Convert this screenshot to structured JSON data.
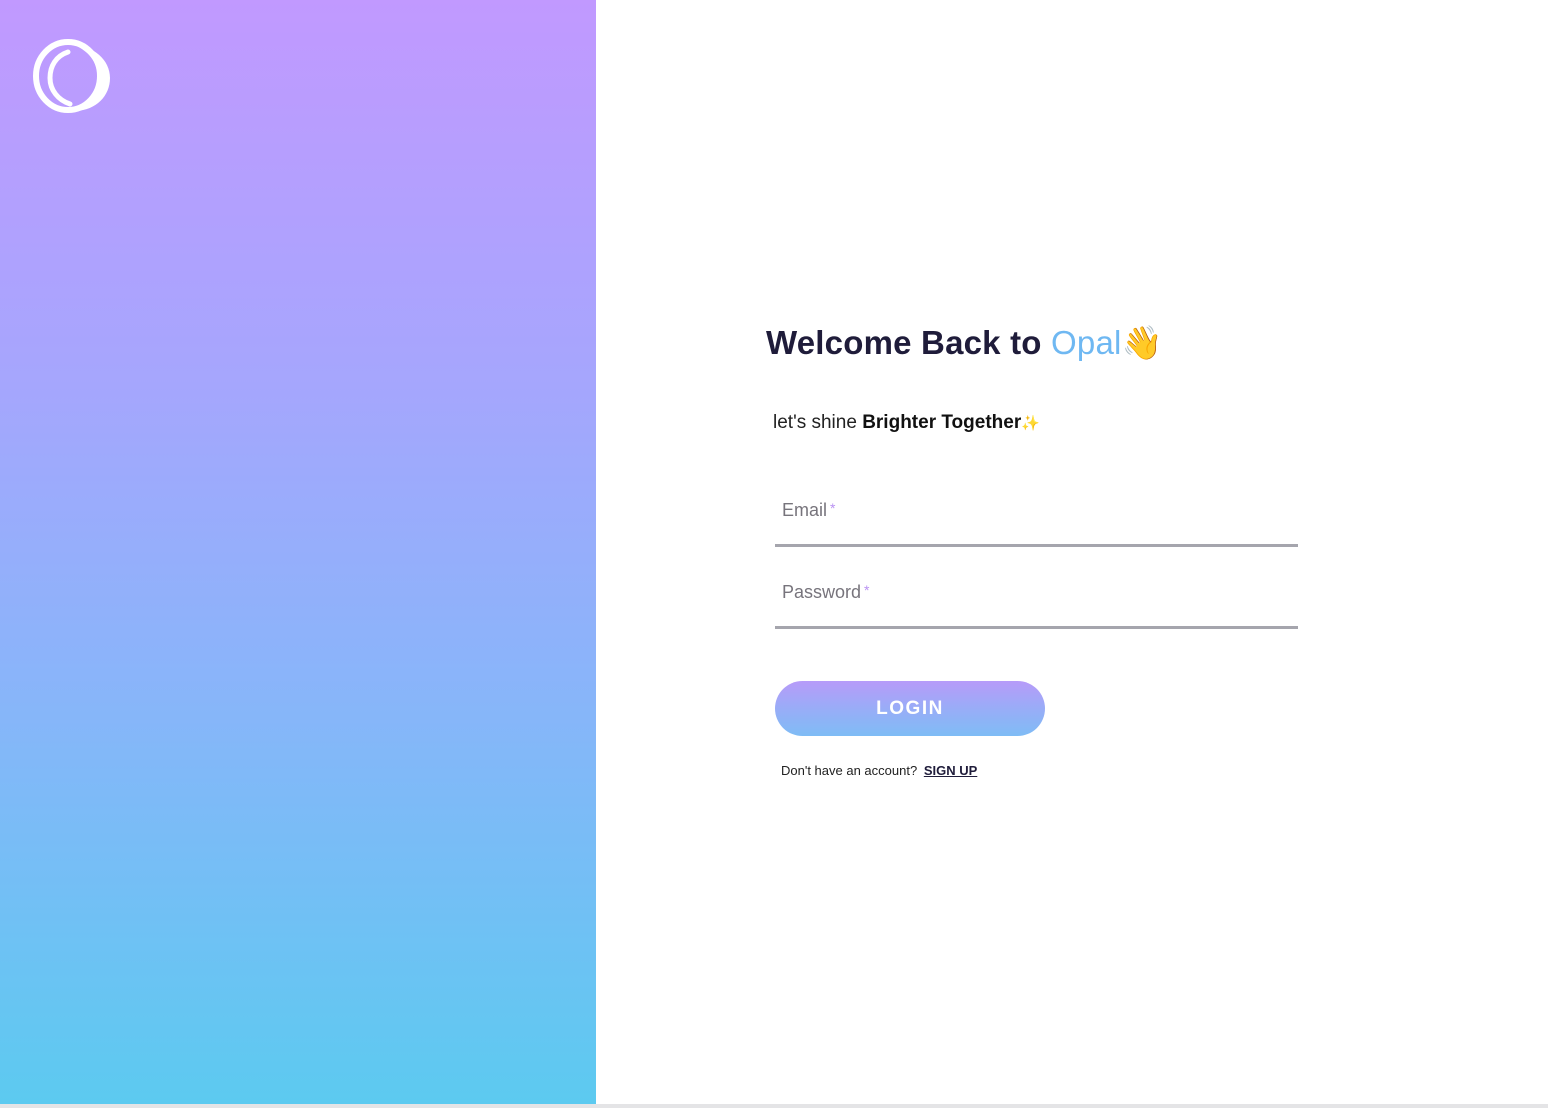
{
  "welcome": {
    "title_prefix": "Welcome Back to ",
    "brand_name": "Opal",
    "wave_emoji": "👋",
    "subtitle_prefix": "let's shine ",
    "subtitle_bold": "Brighter Together",
    "sparkle_emoji": "✨"
  },
  "form": {
    "email_label": "Email",
    "password_label": "Password",
    "required_mark": "*",
    "login_label": "LOGIN",
    "signup_prompt": "Don't have an account?",
    "signup_link": "SIGN UP"
  },
  "colors": {
    "brand_accent": "#6fb8f2",
    "gradient_top": "#c199ff",
    "gradient_bottom": "#5ccaf0",
    "heading_text": "#1f1c3a",
    "required_mark": "#b991f2"
  },
  "icons": {
    "logo": "opal-ring-logo"
  }
}
